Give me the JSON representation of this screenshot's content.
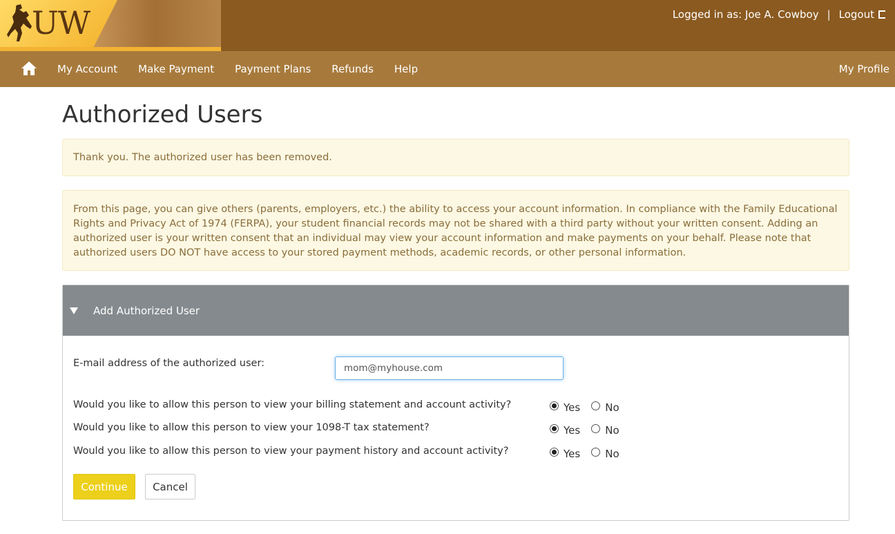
{
  "header": {
    "logo_text": "UW",
    "logged_in_label": "Logged in as: Joe A. Cowboy",
    "separator": "|",
    "logout_label": "Logout"
  },
  "nav": {
    "items": [
      {
        "label": "My Account"
      },
      {
        "label": "Make Payment"
      },
      {
        "label": "Payment Plans"
      },
      {
        "label": "Refunds"
      },
      {
        "label": "Help"
      }
    ],
    "profile_label": "My Profile"
  },
  "page": {
    "title": "Authorized Users"
  },
  "alerts": {
    "removed_message": "Thank you. The authorized user has been removed.",
    "info_message": "From this page, you can give others (parents, employers, etc.) the ability to access your account information. In compliance with the Family Educational Rights and Privacy Act of 1974 (FERPA), your student financial records may not be shared with a third party without your written consent. Adding an authorized user is your written consent that an individual may view your account information and make payments on your behalf. Please note that authorized users DO NOT have access to your stored payment methods, academic records, or other personal information."
  },
  "panel": {
    "title": "Add Authorized User",
    "email_label": "E-mail address of the authorized user:",
    "email_value": "mom@myhouse.com",
    "questions": [
      {
        "text": "Would you like to allow this person to view your billing statement and account activity?",
        "selected": "Yes"
      },
      {
        "text": "Would you like to allow this person to view your 1098-T tax statement?",
        "selected": "Yes"
      },
      {
        "text": "Would you like to allow this person to view your payment history and account activity?",
        "selected": "Yes"
      }
    ],
    "yes_label": "Yes",
    "no_label": "No",
    "continue_label": "Continue",
    "cancel_label": "Cancel"
  },
  "colors": {
    "header_bg": "#8b5a20",
    "nav_bg": "#a77a3c",
    "alert_bg": "#fcf8e3",
    "alert_text": "#8a6d3b",
    "panel_head_bg": "#858a8e",
    "continue_bg": "#edd01b"
  },
  "icons": {
    "home": "home-icon",
    "logout": "logout-icon",
    "caret": "caret-down-icon",
    "logo": "bucking-horse-icon"
  }
}
